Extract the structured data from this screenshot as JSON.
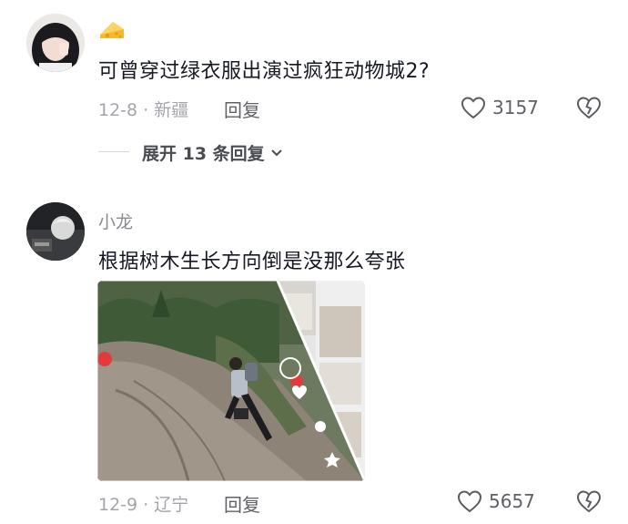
{
  "comment1": {
    "badge_icon": "cheese-badge-icon",
    "text": "可曾穿过绿衣服出演过疯狂动物城2?",
    "date_location": "12-8 · 新疆",
    "reply_label": "回复",
    "like_count": "3157",
    "expand_label": "展开 13 条回复"
  },
  "comment2": {
    "username": "小龙",
    "text": "根据树木生长方向倒是没那么夸张",
    "date_location": "12-9 · 辽宁",
    "reply_label": "回复",
    "like_count": "5657"
  },
  "colors": {
    "text_primary": "#161823",
    "text_secondary": "#a4a5ab",
    "badge": "#f5b82e"
  },
  "icons": [
    "heart-outline-icon",
    "broken-heart-icon",
    "chevron-down-icon"
  ]
}
